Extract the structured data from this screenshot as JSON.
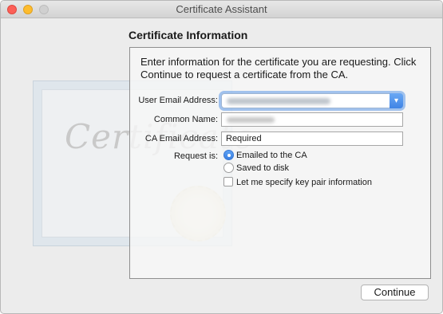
{
  "window": {
    "title": "Certificate Assistant"
  },
  "background": {
    "certificate_word": "Certificate"
  },
  "section": {
    "title": "Certificate Information"
  },
  "intro": "Enter information for the certificate you are requesting. Click Continue to request a certificate from the CA.",
  "form": {
    "user_email_label": "User Email Address:",
    "common_name_label": "Common Name:",
    "ca_email_label": "CA Email Address:",
    "ca_email_value": "Required",
    "request_label": "Request is:",
    "options": {
      "emailed": "Emailed to the CA",
      "saved": "Saved to disk",
      "keypair": "Let me specify key pair information"
    },
    "selected_option": "emailed"
  },
  "buttons": {
    "continue": "Continue"
  },
  "colors": {
    "accent": "#3f84e5"
  },
  "icons": {
    "dropdown": "chevron-down-icon"
  }
}
